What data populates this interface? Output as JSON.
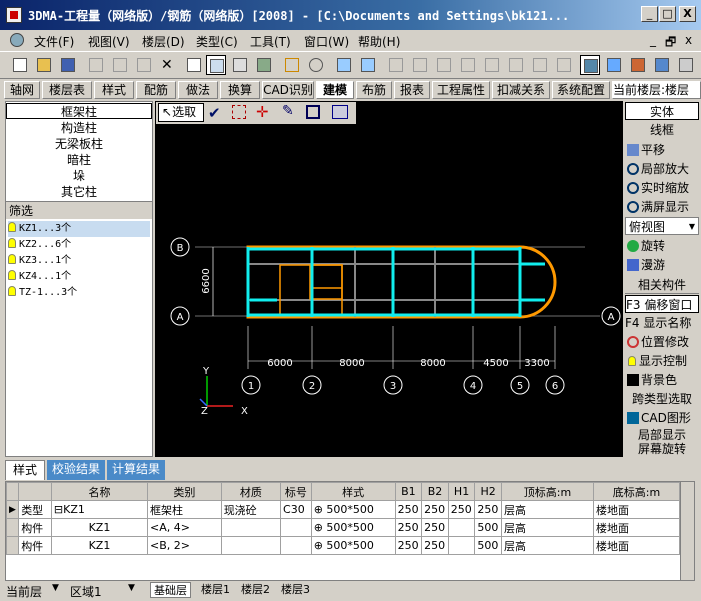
{
  "window": {
    "title": "3DMA-工程量（网络版）/钢筋（网络版）[2008] - [C:\\Documents and Settings\\bk121...",
    "btn_min": "_",
    "btn_max": "□",
    "btn_close": "X",
    "btn_min2": "_",
    "btn_restore": "🗗",
    "btn_close2": "x"
  },
  "menu": [
    "文件(F)",
    "视图(V)",
    "楼层(D)",
    "类型(C)",
    "工具(T)",
    "窗口(W)",
    "帮助(H)"
  ],
  "tabs": [
    "轴网",
    "楼层表",
    "样式",
    "配筋",
    "做法",
    "换算",
    "CAD识别",
    "建模",
    "布筋",
    "报表",
    "工程属性",
    "扣减关系",
    "系统配置",
    "当前楼层:楼层"
  ],
  "active_tab": "建模",
  "left": {
    "types": [
      "框架柱",
      "构造柱",
      "无梁板柱",
      "暗柱",
      "垛",
      "其它柱"
    ],
    "filter_label": "筛选",
    "items": [
      "KZ1...3个",
      "KZ2...6个",
      "KZ3...1个",
      "KZ4...1个",
      "TZ-1...3个"
    ]
  },
  "canvas_tools": {
    "select_label": "选取"
  },
  "drawing": {
    "axis_b": "B",
    "axis_a": "A",
    "axis_a2": "A",
    "dim_vertical": "6600",
    "dims": [
      "6000",
      "8000",
      "8000",
      "4500",
      "3300"
    ],
    "axis_numbers": [
      "1",
      "2",
      "3",
      "4",
      "5",
      "6"
    ],
    "y_label": "Y",
    "z_label": "Z",
    "x_label": "X"
  },
  "right": {
    "solid": "实体",
    "wire": "线框",
    "pan": "平移",
    "zoom_local": "局部放大",
    "zoom_realtime": "实时缩放",
    "fullscreen": "满屏显示",
    "view_select": "俯视图",
    "rotate": "旋转",
    "wander": "漫游",
    "related": "相关构件",
    "f3": "F3 偏移窗口",
    "f4": "F4 显示名称",
    "pos_edit": "位置修改",
    "display_ctrl": "显示控制",
    "bg_color": "背景色",
    "cross_select": "跨类型选取",
    "cad_graphic": "CAD图形",
    "local_display": "局部显示",
    "screen_rotate": "屏幕旋转"
  },
  "bottom_tabs": [
    "样式",
    "校验结果",
    "计算结果"
  ],
  "grid": {
    "headers": [
      "",
      "名称",
      "类别",
      "材质",
      "标号",
      "样式",
      "B1",
      "B2",
      "H1",
      "H2",
      "顶标高:m",
      "底标高:m"
    ],
    "rows": [
      [
        "类型",
        "⊟KZ1",
        "框架柱",
        "现浇砼",
        "C30",
        "500*500",
        "250",
        "250",
        "250",
        "250",
        "层高",
        "楼地面"
      ],
      [
        "构件",
        "KZ1",
        "<A, 4>",
        "",
        "",
        "500*500",
        "250",
        "250",
        "",
        "500",
        "层高",
        "楼地面"
      ],
      [
        "构件",
        "KZ1",
        "<B, 2>",
        "",
        "",
        "500*500",
        "250",
        "250",
        "",
        "500",
        "层高",
        "楼地面"
      ]
    ]
  },
  "status": {
    "floor_label": "当前层",
    "area_label": "区域1",
    "sheets": [
      "基础层",
      "楼层1",
      "楼层2",
      "楼层3"
    ]
  }
}
